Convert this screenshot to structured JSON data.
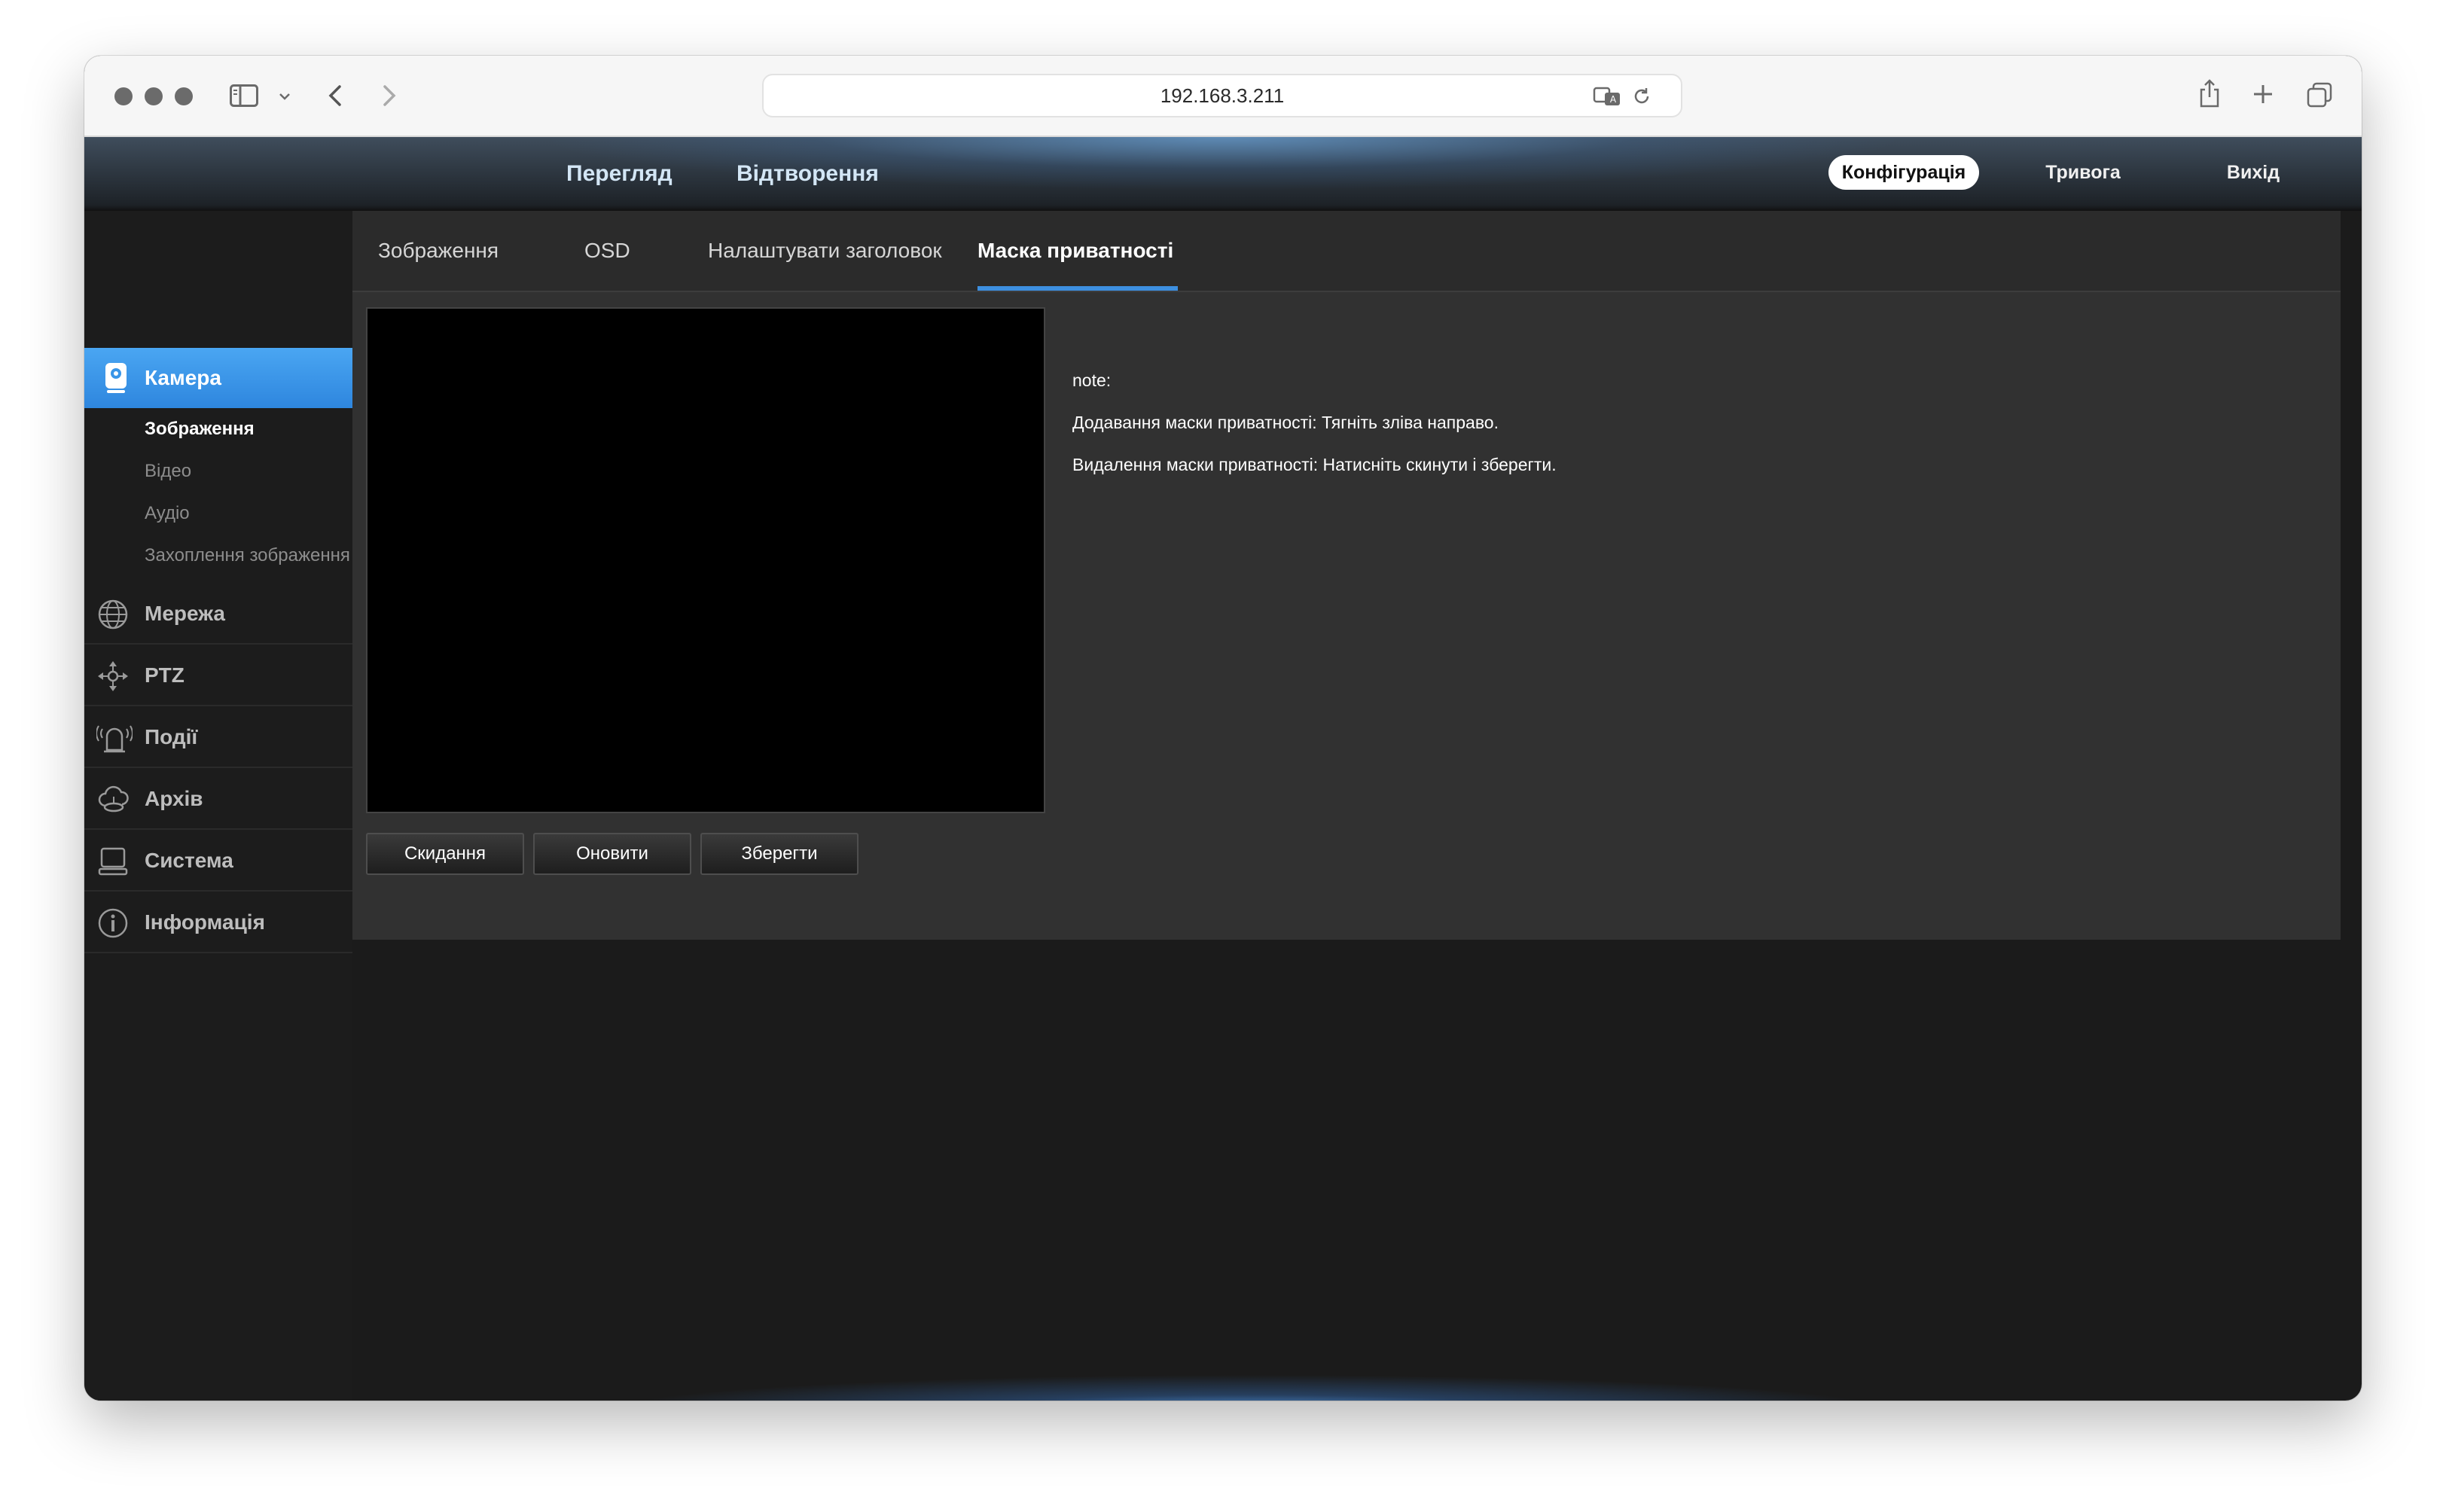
{
  "browser": {
    "url": "192.168.3.211"
  },
  "header": {
    "nav_left": [
      "Перегляд",
      "Відтворення"
    ],
    "nav_right": [
      "Конфігурація",
      "Тривога",
      "Вихід"
    ],
    "active": "Конфігурація"
  },
  "sidebar": {
    "active_section": "Камера",
    "camera_subitems": [
      "Зображення",
      "Відео",
      "Аудіо",
      "Захоплення зображення"
    ],
    "active_subitem": "Зображення",
    "items": [
      {
        "label": "Мережа",
        "icon": "network-globe-icon"
      },
      {
        "label": "PTZ",
        "icon": "ptz-arrows-icon"
      },
      {
        "label": "Події",
        "icon": "alarm-icon"
      },
      {
        "label": "Архів",
        "icon": "cloud-storage-icon"
      },
      {
        "label": "Система",
        "icon": "computer-icon"
      },
      {
        "label": "Інформація",
        "icon": "info-icon"
      }
    ]
  },
  "tabs": {
    "items": [
      "Зображення",
      "OSD",
      "Налаштувати заголовок",
      "Маска приватності"
    ],
    "active": "Маска приватності"
  },
  "buttons": {
    "reset": "Скидання",
    "refresh": "Оновити",
    "save": "Зберегти"
  },
  "notes": {
    "title": "note:",
    "add": "Додавання маски приватності: Тягніть зліва направо.",
    "remove": "Видалення маски приватності: Натисніть скинути і зберегти."
  },
  "colors": {
    "accent": "#3d8fe0",
    "sidebar_active": "#3a96e8",
    "panel_bg": "#313131",
    "page_bg": "#1b1b1b"
  }
}
